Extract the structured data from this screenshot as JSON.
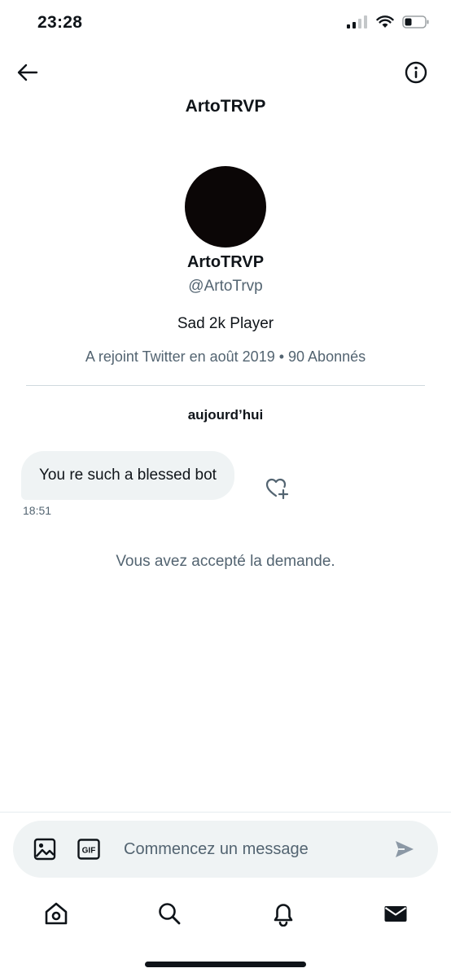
{
  "status_bar": {
    "time": "23:28",
    "icons": [
      "cellular-signal-icon",
      "wifi-icon",
      "battery-icon"
    ]
  },
  "header": {
    "title": "ArtoTRVP",
    "back_icon": "back-arrow-icon",
    "info_icon": "info-icon"
  },
  "profile": {
    "name": "ArtoTRVP",
    "handle": "@ArtoTrvp",
    "bio": "Sad 2k Player",
    "meta": "A rejoint Twitter en août 2019 • 90 Abonnés"
  },
  "conversation": {
    "date_separator": "aujourd’hui",
    "messages": [
      {
        "text": "You re such a blessed bot",
        "time": "18:51"
      }
    ],
    "system_note": "Vous avez accepté la demande."
  },
  "composer": {
    "placeholder": "Commencez un message",
    "value": "",
    "gif_label": "GIF"
  },
  "bottom_nav": {
    "items": [
      "home-icon",
      "search-icon",
      "notifications-icon",
      "messages-icon"
    ],
    "active": "messages-icon"
  },
  "colors": {
    "text_primary": "#0f1419",
    "text_secondary": "#536471",
    "bubble_bg": "#eff3f4",
    "divider": "#cfd9de"
  }
}
